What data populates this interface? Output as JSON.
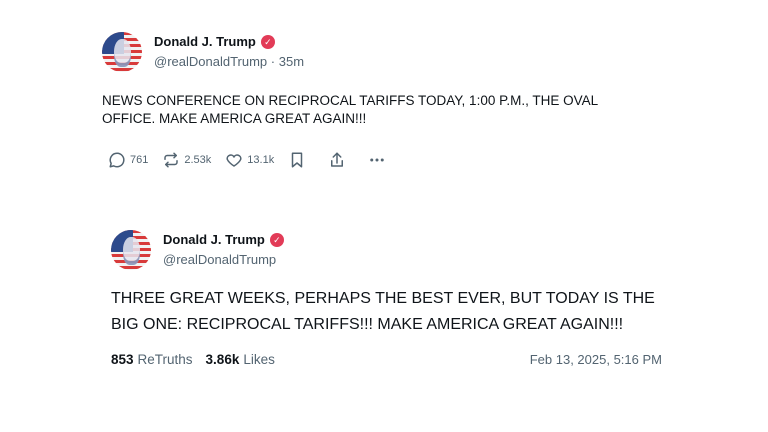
{
  "post1": {
    "display_name": "Donald J. Trump",
    "verified_mark": "✓",
    "handle": "@realDonaldTrump",
    "separator": "·",
    "time_ago": "35m",
    "text": "NEWS CONFERENCE ON RECIPROCAL TARIFFS TODAY, 1:00 P.M., THE OVAL OFFICE. MAKE AMERICA GREAT AGAIN!!!",
    "actions": {
      "reply_count": "761",
      "retruth_count": "2.53k",
      "like_count": "13.1k"
    }
  },
  "post2": {
    "display_name": "Donald J. Trump",
    "verified_mark": "✓",
    "handle": "@realDonaldTrump",
    "text": "THREE GREAT WEEKS, PERHAPS THE BEST EVER, BUT TODAY IS THE BIG ONE: RECIPROCAL TARIFFS!!! MAKE AMERICA GREAT AGAIN!!!",
    "retruths_count": "853",
    "retruths_label": "ReTruths",
    "likes_count": "3.86k",
    "likes_label": "Likes",
    "timestamp": "Feb 13, 2025, 5:16 PM"
  },
  "icons": {
    "reply": "reply-icon",
    "retruth": "retruth-icon",
    "like": "heart-icon",
    "bookmark": "bookmark-icon",
    "share": "share-icon",
    "more": "more-icon",
    "verified": "verified-badge-icon"
  },
  "colors": {
    "verified_badge": "#e23b57",
    "secondary_text": "#536471",
    "primary_text": "#0f1419"
  }
}
